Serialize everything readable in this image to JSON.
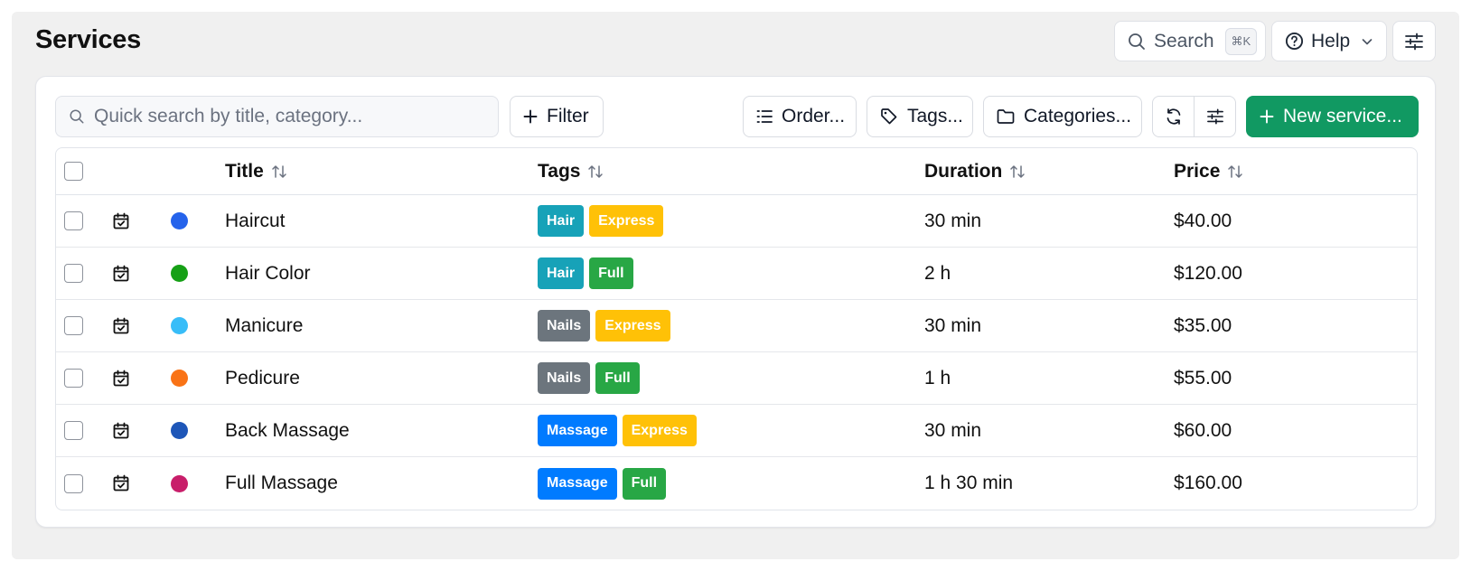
{
  "header": {
    "title": "Services",
    "search_label": "Search",
    "search_shortcut": "⌘K",
    "help_label": "Help"
  },
  "toolbar": {
    "quick_search_placeholder": "Quick search by title, category...",
    "filter_label": "Filter",
    "order_label": "Order...",
    "tags_label": "Tags...",
    "categories_label": "Categories...",
    "new_label": "New service..."
  },
  "columns": {
    "title": "Title",
    "tags": "Tags",
    "duration": "Duration",
    "price": "Price"
  },
  "rows": [
    {
      "title": "Haircut",
      "color": "#2563eb",
      "tags": [
        {
          "label": "Hair",
          "color": "#17a2b8"
        },
        {
          "label": "Express",
          "color": "#ffc107"
        }
      ],
      "duration": "30 min",
      "price": "$40.00"
    },
    {
      "title": "Hair Color",
      "color": "#16a016",
      "tags": [
        {
          "label": "Hair",
          "color": "#17a2b8"
        },
        {
          "label": "Full",
          "color": "#28a745"
        }
      ],
      "duration": "2 h",
      "price": "$120.00"
    },
    {
      "title": "Manicure",
      "color": "#38bdf8",
      "tags": [
        {
          "label": "Nails",
          "color": "#6c757d"
        },
        {
          "label": "Express",
          "color": "#ffc107"
        }
      ],
      "duration": "30 min",
      "price": "$35.00"
    },
    {
      "title": "Pedicure",
      "color": "#f97316",
      "tags": [
        {
          "label": "Nails",
          "color": "#6c757d"
        },
        {
          "label": "Full",
          "color": "#28a745"
        }
      ],
      "duration": "1 h",
      "price": "$55.00"
    },
    {
      "title": "Back Massage",
      "color": "#1e56b8",
      "tags": [
        {
          "label": "Massage",
          "color": "#007bff"
        },
        {
          "label": "Express",
          "color": "#ffc107"
        }
      ],
      "duration": "30 min",
      "price": "$60.00"
    },
    {
      "title": "Full Massage",
      "color": "#c81e6a",
      "tags": [
        {
          "label": "Massage",
          "color": "#007bff"
        },
        {
          "label": "Full",
          "color": "#28a745"
        }
      ],
      "duration": "1 h 30 min",
      "price": "$160.00"
    }
  ],
  "colors": {
    "primary": "#119962"
  }
}
